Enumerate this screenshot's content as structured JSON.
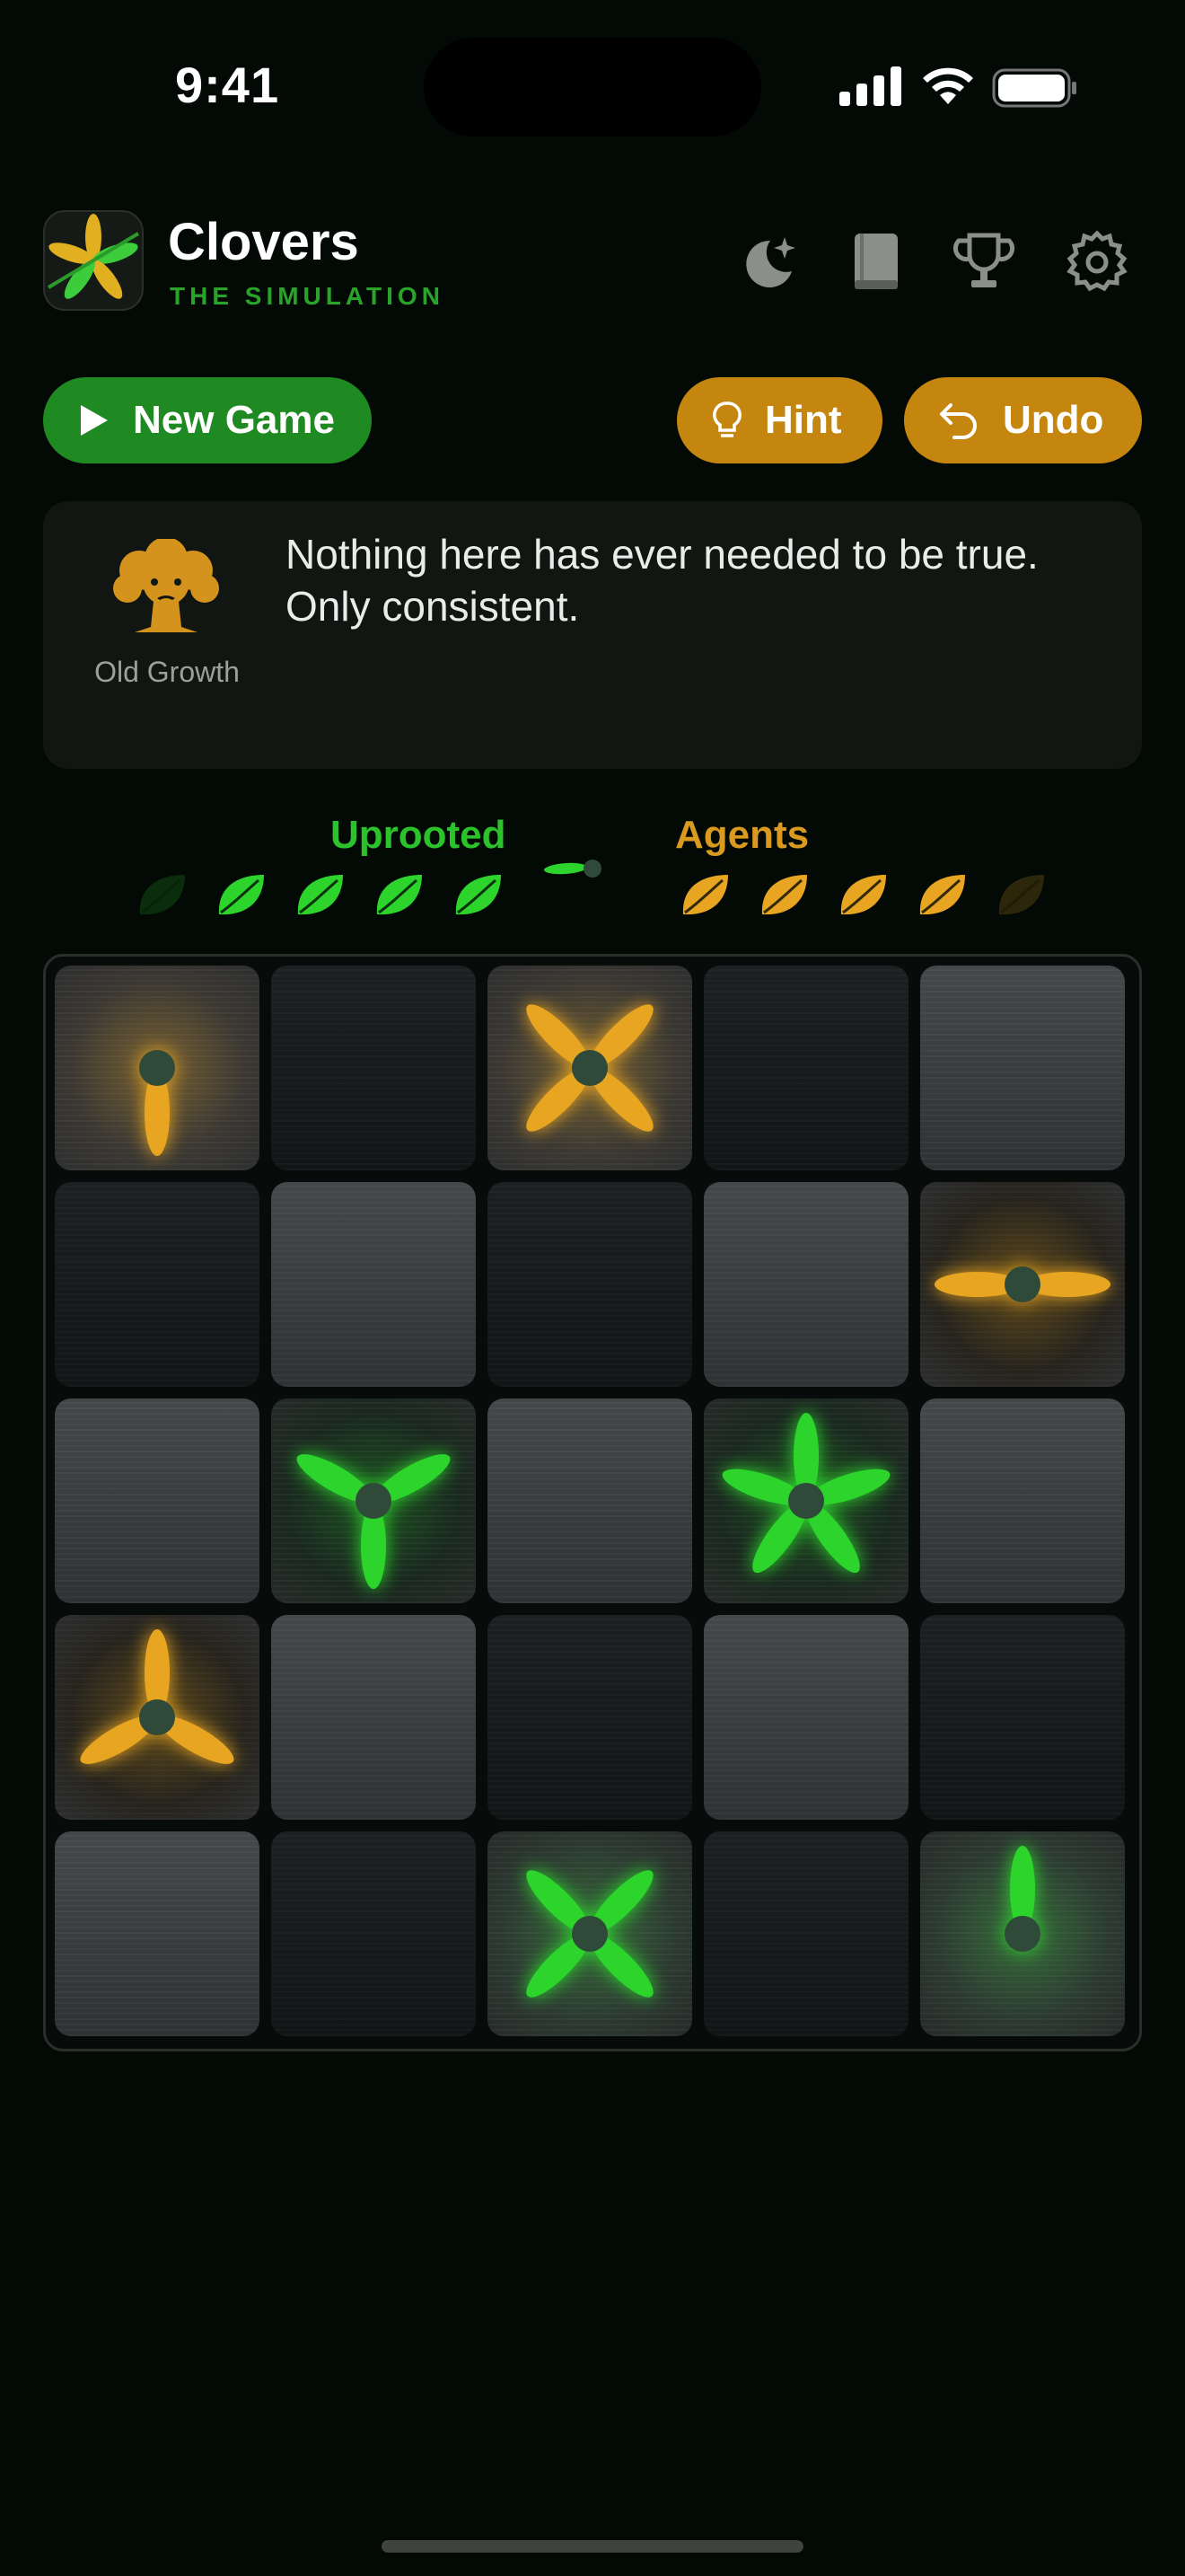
{
  "status_bar": {
    "time": "9:41"
  },
  "header": {
    "title": "Clovers",
    "subtitle": "THE SIMULATION",
    "icons": [
      "night-mode-icon",
      "rules-book-icon",
      "trophy-icon",
      "settings-gear-icon"
    ]
  },
  "buttons": {
    "new_game": "New Game",
    "hint": "Hint",
    "undo": "Undo"
  },
  "card": {
    "character_name": "Old Growth",
    "character_icon": "oak-tree-icon",
    "quote": "Nothing here has ever needed to be true. Only consistent."
  },
  "score": {
    "uprooted_label": "Uprooted",
    "agents_label": "Agents",
    "uprooted_leaves": [
      false,
      true,
      true,
      true,
      true
    ],
    "agents_leaves": [
      true,
      true,
      true,
      true,
      false
    ],
    "turn": "player"
  },
  "colors": {
    "player_green": "#2cd42c",
    "agent_gold": "#e8a521",
    "button_green": "#1f8a22",
    "button_gold": "#c4860f",
    "background": "#030a05"
  },
  "board": {
    "rows": 5,
    "cols": 5,
    "cells": [
      [
        {
          "shade": "light",
          "owner": "gold",
          "petals": 1,
          "dir": "down"
        },
        {
          "shade": "dark"
        },
        {
          "shade": "light",
          "owner": "gold",
          "petals": 4,
          "dir": "diag"
        },
        {
          "shade": "dark"
        },
        {
          "shade": "light"
        }
      ],
      [
        {
          "shade": "dark"
        },
        {
          "shade": "light"
        },
        {
          "shade": "dark"
        },
        {
          "shade": "light"
        },
        {
          "shade": "dark",
          "owner": "gold",
          "petals": 2,
          "dir": "horizontal"
        }
      ],
      [
        {
          "shade": "light"
        },
        {
          "shade": "dark",
          "owner": "green",
          "petals": 3,
          "dir": "down"
        },
        {
          "shade": "light"
        },
        {
          "shade": "dark",
          "owner": "green",
          "petals": 5,
          "dir": "up"
        },
        {
          "shade": "light"
        }
      ],
      [
        {
          "shade": "dark",
          "owner": "gold",
          "petals": 3,
          "dir": "up"
        },
        {
          "shade": "light"
        },
        {
          "shade": "dark"
        },
        {
          "shade": "light"
        },
        {
          "shade": "dark"
        }
      ],
      [
        {
          "shade": "light"
        },
        {
          "shade": "dark"
        },
        {
          "shade": "light",
          "owner": "green",
          "petals": 4,
          "dir": "diag"
        },
        {
          "shade": "dark"
        },
        {
          "shade": "light",
          "owner": "green",
          "petals": 1,
          "dir": "up"
        }
      ]
    ]
  }
}
